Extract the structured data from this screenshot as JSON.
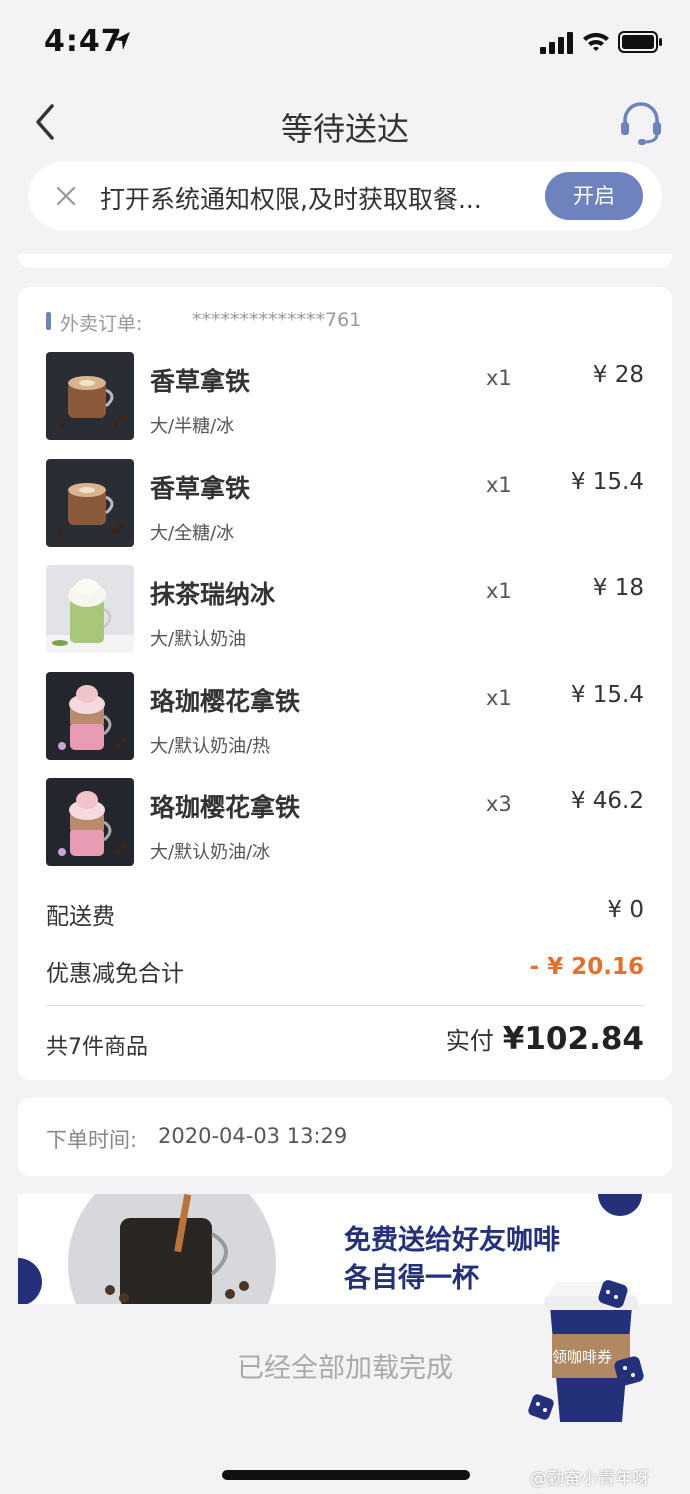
{
  "status_bar": {
    "time": "4:47"
  },
  "nav": {
    "title": "等待送达"
  },
  "notice": {
    "text": "打开系统通知权限,及时获取取餐...",
    "button": "开启"
  },
  "order": {
    "label": "外卖订单:",
    "number": "**************761",
    "items": [
      {
        "name": "香草拿铁",
        "spec": "大/半糖/冰",
        "qty": "x1",
        "price": "¥ 28",
        "image": "vanilla-latte-image"
      },
      {
        "name": "香草拿铁",
        "spec": "大/全糖/冰",
        "qty": "x1",
        "price": "¥ 15.4",
        "image": "vanilla-latte-image"
      },
      {
        "name": "抹茶瑞纳冰",
        "spec": "大/默认奶油",
        "qty": "x1",
        "price": "¥ 18",
        "image": "matcha-frappe-image"
      },
      {
        "name": "珞珈樱花拿铁",
        "spec": "大/默认奶油/热",
        "qty": "x1",
        "price": "¥ 15.4",
        "image": "sakura-latte-image"
      },
      {
        "name": "珞珈樱花拿铁",
        "spec": "大/默认奶油/冰",
        "qty": "x3",
        "price": "¥ 46.2",
        "image": "sakura-latte-image"
      }
    ],
    "delivery_fee_label": "配送费",
    "delivery_fee": "¥ 0",
    "discount_label": "优惠减免合计",
    "discount": "- ¥ 20.16",
    "count_text": "共7件商品",
    "paid_label": "实付",
    "paid_value": "¥102.84"
  },
  "order_time": {
    "label": "下单时间:",
    "value": "2020-04-03 13:29"
  },
  "banner": {
    "line1": "免费送给好友咖啡",
    "line2": "各自得一杯"
  },
  "coupon": {
    "label": "领咖啡券"
  },
  "footer": {
    "loaded": "已经全部加载完成"
  },
  "watermark": "@勤奋小青年呀",
  "colors": {
    "accent": "#6e82bd",
    "discount": "#e2712f",
    "banner_text": "#24317a"
  }
}
